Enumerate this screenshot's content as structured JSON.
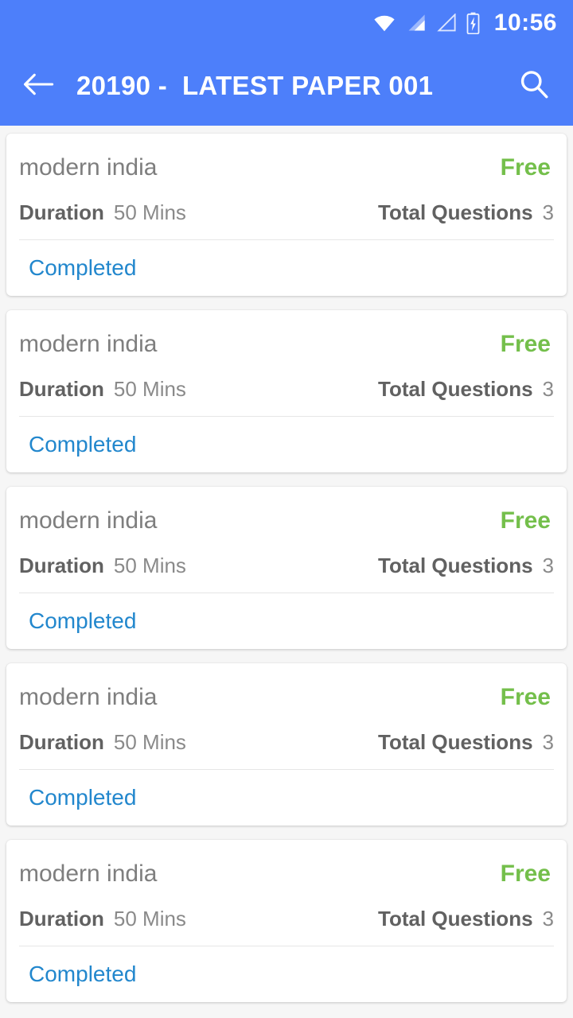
{
  "status_bar": {
    "time": "10:56",
    "icons": [
      "wifi-icon",
      "signal-strong-icon",
      "signal-empty-icon",
      "battery-charging-icon"
    ]
  },
  "app_bar": {
    "back_icon": "back-arrow-icon",
    "title": "20190 -  LATEST PAPER 001",
    "search_icon": "search-icon"
  },
  "colors": {
    "primary": "#4d7ffa",
    "free_green": "#74bf4b",
    "link_blue": "#2287cd",
    "page_background": "#f6f6f6",
    "card_background": "#ffffff",
    "title_gray": "#7e7e7e",
    "label_gray": "#616161",
    "value_gray": "#8a8a8a",
    "divider_gray": "#e6e6e6"
  },
  "list": {
    "labels": {
      "duration": "Duration",
      "total_questions": "Total Questions"
    },
    "items": [
      {
        "title": "modern india",
        "price": "Free",
        "duration": "50 Mins",
        "questions": "3",
        "status": "Completed"
      },
      {
        "title": "modern india",
        "price": "Free",
        "duration": "50 Mins",
        "questions": "3",
        "status": "Completed"
      },
      {
        "title": "modern india",
        "price": "Free",
        "duration": "50 Mins",
        "questions": "3",
        "status": "Completed"
      },
      {
        "title": "modern india",
        "price": "Free",
        "duration": "50 Mins",
        "questions": "3",
        "status": "Completed"
      },
      {
        "title": "modern india",
        "price": "Free",
        "duration": "50 Mins",
        "questions": "3",
        "status": "Completed"
      }
    ]
  }
}
